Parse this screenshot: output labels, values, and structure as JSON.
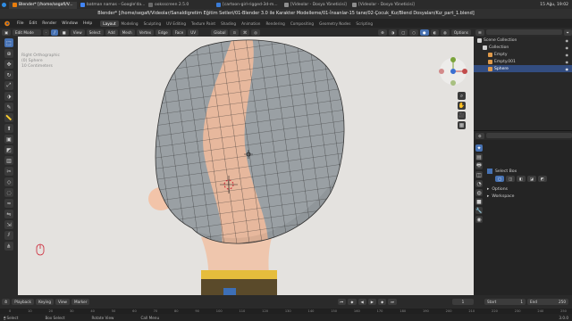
{
  "taskbar": {
    "tabs": [
      {
        "label": "Blender* [/home/segafi/V...",
        "color": "#e87d0d",
        "active": true
      },
      {
        "label": "batman namas - Google'da...",
        "color": "#4285f4",
        "active": false
      },
      {
        "label": "ooksscreen 2.5.0",
        "color": "#6a6a6a",
        "active": false
      },
      {
        "label": "[cartoon-girl-rigged-3d-m...",
        "color": "#3a7bd5",
        "active": false
      },
      {
        "label": "[Videolar - Dosya Yöneticisi]",
        "color": "#8e8e8e",
        "active": false
      },
      {
        "label": "[Videolar - Dosya Yöneticisi]",
        "color": "#8e8e8e",
        "active": false
      }
    ],
    "clock": "15 Ağu, 19:02"
  },
  "title_bar": {
    "text": "Blender* [/home/segafi/Videolar/Sanaldigretim Eğitim Setleri/01-Blender 3.0 ile Karakter Modelleme/01-İnsanlar-15 tane/02-Çocuk_Kız/Blend Dosyaları/Kız_part_1.blend]"
  },
  "menu": {
    "items": [
      "File",
      "Edit",
      "Render",
      "Window",
      "Help"
    ],
    "workspace_tabs": [
      "Layout",
      "Modeling",
      "Sculpting",
      "UV Editing",
      "Texture Paint",
      "Shading",
      "Animation",
      "Rendering",
      "Compositing",
      "Geometry Nodes",
      "Scripting"
    ],
    "active_workspace": "Layout",
    "scene": "Scene",
    "view_layer": "View Layer"
  },
  "viewport_header": {
    "mode": "Edit Mode",
    "menus": [
      "View",
      "Select",
      "Add",
      "Mesh",
      "Vertex",
      "Edge",
      "Face",
      "UV"
    ],
    "orientation": "Global",
    "options": "Options"
  },
  "viewport_overlay": {
    "lines": [
      "Right Orthographic",
      "(0) Sphere",
      "10 Centimeters"
    ],
    "skin_color": "#e7b89d",
    "mesh_color": "#9a9ea1"
  },
  "outliner": {
    "search_placeholder": "",
    "items": [
      {
        "label": "Scene Collection",
        "indent": 0,
        "selected": false
      },
      {
        "label": "Collection",
        "indent": 1,
        "selected": false
      },
      {
        "label": "Empty",
        "indent": 2,
        "selected": false
      },
      {
        "label": "Empty.001",
        "indent": 2,
        "selected": false
      },
      {
        "label": "Sphere",
        "indent": 2,
        "selected": true
      }
    ]
  },
  "properties": {
    "tool": "Select Box",
    "sections": [
      "Options",
      "Workspace"
    ]
  },
  "timeline": {
    "menus": [
      "Playback",
      "Keying",
      "View",
      "Marker"
    ],
    "current_frame": "1",
    "start_label": "Start",
    "start": "1",
    "end_label": "End",
    "end": "250",
    "ticks": [
      "0",
      "10",
      "20",
      "30",
      "40",
      "50",
      "60",
      "70",
      "80",
      "90",
      "100",
      "110",
      "120",
      "130",
      "140",
      "150",
      "160",
      "170",
      "180",
      "190",
      "200",
      "210",
      "220",
      "230",
      "240",
      "250"
    ]
  },
  "status_bar": {
    "items": [
      "Select",
      "Box Select",
      "Rotate View",
      "Call Menu"
    ],
    "version": "3.0.0"
  }
}
